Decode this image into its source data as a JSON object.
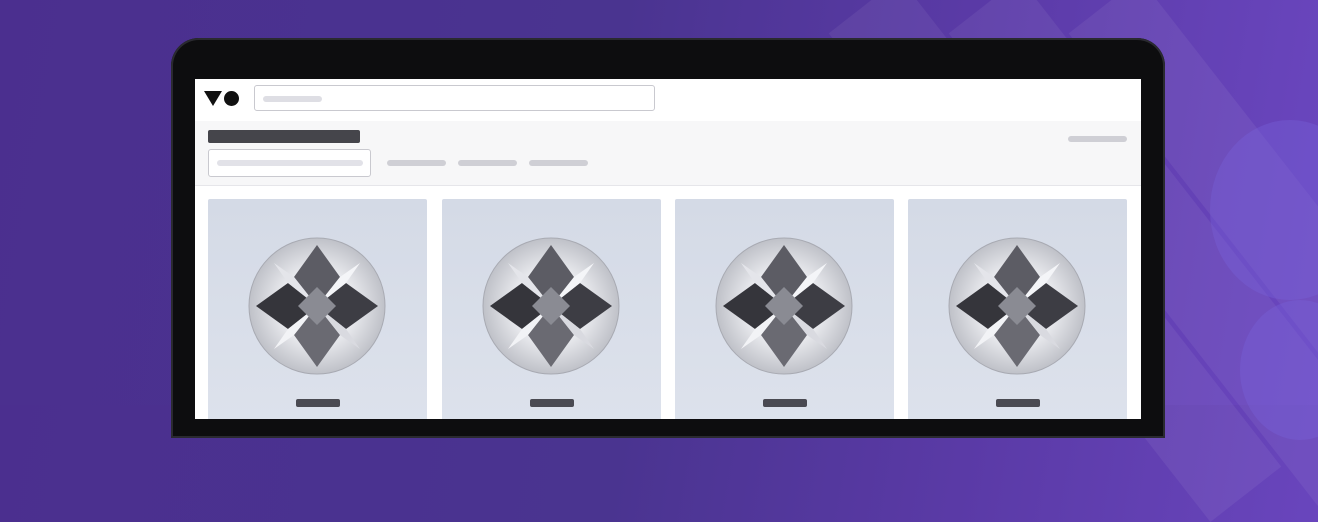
{
  "app": {
    "logo_name": "logo-icon"
  },
  "header": {
    "search_placeholder": ""
  },
  "filters": {
    "page_title": "",
    "sort_label": "",
    "filter_placeholder": "",
    "chips": [
      "",
      "",
      ""
    ]
  },
  "products": [
    {
      "price": ""
    },
    {
      "price": ""
    },
    {
      "price": ""
    },
    {
      "price": ""
    }
  ],
  "colors": {
    "background_accent": "#4b2f8f",
    "card_background": "#d4dae6",
    "laptop_bezel": "#0d0d0f"
  }
}
